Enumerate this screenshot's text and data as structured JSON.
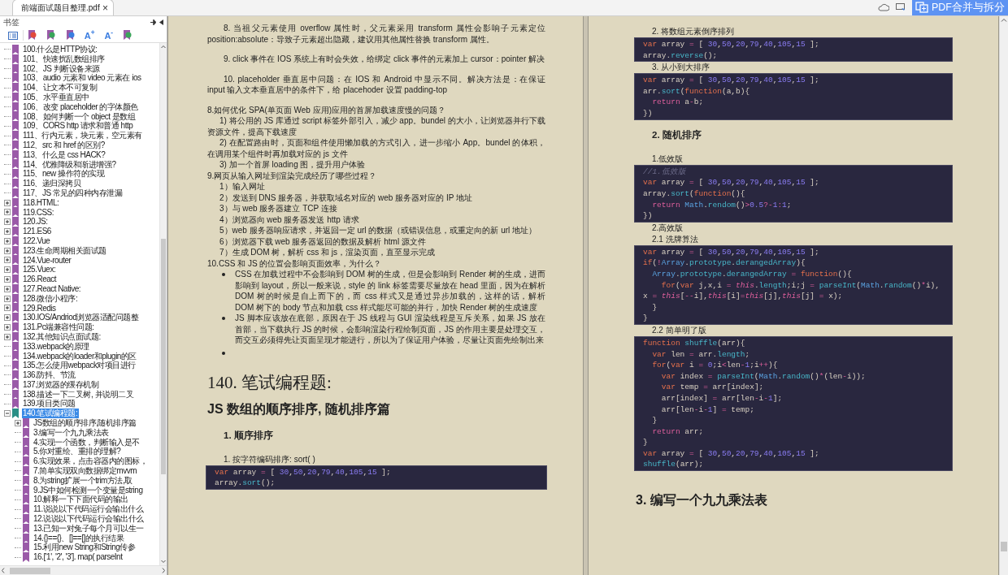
{
  "tab": {
    "title": "前端面试题目整理.pdf",
    "close": "×"
  },
  "merge_button": "PDF合并与拆分",
  "bookmarks": {
    "title": "书签",
    "tools": [
      {
        "kind": "outline"
      },
      {
        "kind": "bookmark",
        "color": "#e24a3b"
      },
      {
        "kind": "bookmark",
        "color": "#3aa55a"
      },
      {
        "kind": "bookmark",
        "color": "#3b7de0"
      },
      {
        "kind": "font",
        "label": "A$^{+}$"
      },
      {
        "kind": "font",
        "label": "A$^{-}$"
      },
      {
        "kind": "bookmark",
        "color": "#3aa55a"
      }
    ],
    "items": [
      {
        "label": "100.什么是HTTP协议:",
        "selected": false
      },
      {
        "label": "101、快速扰乱数组排序",
        "selected": false
      },
      {
        "label": "102、JS 判断设备来源",
        "selected": false
      },
      {
        "label": "103、audio 元素和 video 元素在 ios",
        "selected": false
      },
      {
        "label": "104、让文本不可复制",
        "selected": false
      },
      {
        "label": "105、水平垂直居中",
        "selected": false
      },
      {
        "label": "106、改变 placeholder 的字体颜色",
        "selected": false
      },
      {
        "label": "108、如何判断一个 object 是数组",
        "selected": false
      },
      {
        "label": "109、CORS http 请求和普通 http",
        "selected": false
      },
      {
        "label": "111、行内元素，块元素，空元素有",
        "selected": false
      },
      {
        "label": "112、src 和 href 的区别?",
        "selected": false
      },
      {
        "label": "113、什么是 css HACK?",
        "selected": false
      },
      {
        "label": "114、优雅降级和渐进增强?",
        "selected": false
      },
      {
        "label": "115、new 操作符的实现",
        "selected": false
      },
      {
        "label": "116、递归深拷贝",
        "selected": false
      },
      {
        "label": "117、JS 常见的四种内存泄漏",
        "selected": false
      },
      {
        "label": "118.HTML:",
        "selected": false,
        "expanded": false
      },
      {
        "label": "119.CSS:",
        "selected": false,
        "expanded": false
      },
      {
        "label": "120.JS:",
        "selected": false,
        "expanded": false
      },
      {
        "label": "121.ES6",
        "selected": false,
        "expanded": false
      },
      {
        "label": "122.Vue",
        "selected": false,
        "expanded": false
      },
      {
        "label": "123.生命周期相关面试题",
        "selected": false,
        "expanded": false
      },
      {
        "label": "124.Vue-router",
        "selected": false,
        "expanded": false
      },
      {
        "label": "125.Vuex:",
        "selected": false,
        "expanded": false
      },
      {
        "label": "126.React",
        "selected": false,
        "expanded": false
      },
      {
        "label": "127.React Native:",
        "selected": false,
        "expanded": false
      },
      {
        "label": "128.微信小程序:",
        "selected": false,
        "expanded": false
      },
      {
        "label": "129.Redis",
        "selected": false,
        "expanded": false
      },
      {
        "label": "130.IOS/Andriod浏览器适配问题整",
        "selected": false,
        "expanded": false
      },
      {
        "label": "131.Pc端兼容性问题:",
        "selected": false,
        "expanded": false
      },
      {
        "label": "132.其他知识点面试题:",
        "selected": false,
        "expanded": false
      },
      {
        "label": "133.webpack的原理",
        "selected": false
      },
      {
        "label": "134.webpack的loader和plugin的区",
        "selected": false
      },
      {
        "label": "135.怎么使用webpack对项目进行",
        "selected": false
      },
      {
        "label": "136.防抖、节流",
        "selected": false
      },
      {
        "label": "137.浏览器的缓存机制",
        "selected": false
      },
      {
        "label": "138.描述一下二叉树, 并说明二叉",
        "selected": false
      },
      {
        "label": "139.项目类问题",
        "selected": false
      },
      {
        "label": "140.笔试编程题:",
        "selected": true,
        "expanded": true,
        "children": [
          {
            "label": "JS数组的顺序排序,随机排序篇",
            "selected": false,
            "expanded": false
          },
          {
            "label": "3.编写一个九九乘法表",
            "selected": false
          },
          {
            "label": "4.实现一个函数，判断输入是不",
            "selected": false
          },
          {
            "label": "5.你对重绘、重排的理解?",
            "selected": false
          },
          {
            "label": "6.实现效果，点击容器内的图标，",
            "selected": false
          },
          {
            "label": "7.简单实现双向数据绑定mvvm",
            "selected": false
          },
          {
            "label": "8.为string扩展一个trim方法,取",
            "selected": false
          },
          {
            "label": "9.JS中如何检测一个变量是string",
            "selected": false
          },
          {
            "label": "10.解释一下下面代码的输出",
            "selected": false
          },
          {
            "label": "11.说说以下代码运行会输出什么",
            "selected": false
          },
          {
            "label": "12.说说以下代码运行会输出什么",
            "selected": false
          },
          {
            "label": "13.已知一对兔子每个月可以生一",
            "selected": false
          },
          {
            "label": "14.{}=={}、[]==[]的执行结果",
            "selected": false
          },
          {
            "label": "15.利用new String和String传参",
            "selected": false
          },
          {
            "label": "16.['1', '2', '3']. map( parseInt",
            "selected": false
          }
        ]
      }
    ]
  },
  "pages": [
    {
      "blocks": [
        {
          "kind": "para",
          "text": "8. 当祖父元素使用 overflow 属性时，父元素采用 transform 属性会影响子元素定位 position:absolute：导致子元素超出隐藏，建议用其他属性替换 transform 属性。"
        },
        {
          "kind": "para",
          "text": "9. click 事件在 IOS 系统上有时会失效，给绑定 click 事件的元素加上 cursor：pointer 解决"
        },
        {
          "kind": "para",
          "text": "10. placeholder 垂直居中问题：在 IOS 和 Android 中显示不同。解决方法是：在保证 input 输入文本垂直居中的条件下，给 placehoder 设置 padding-top"
        },
        {
          "kind": "line",
          "text": "8.如何优化 SPA(单页面 Web 应用)应用的首屏加载速度慢的问题？"
        },
        {
          "kind": "step",
          "text": "1) 将公用的 JS 库通过 script 标签外部引入，减少 app。bundel 的大小，让浏览器并行下载资源文件，提高下载速度"
        },
        {
          "kind": "step",
          "text": "2) 在配置路由时，页面和组件使用懒加载的方式引入，进一步缩小 App。bundel 的体积，在调用某个组件时再加载对应的 js 文件"
        },
        {
          "kind": "step",
          "text": "3) 加一个首屏 loading 图，提升用户体验"
        },
        {
          "kind": "line",
          "text": "9.网页从输入网址到渲染完成经历了哪些过程？"
        },
        {
          "kind": "step",
          "text": "1）输入网址"
        },
        {
          "kind": "step",
          "text": "2）发送到 DNS 服务器，并获取域名对应的 web 服务器对应的 IP 地址"
        },
        {
          "kind": "step",
          "text": "3）与 web 服务器建立 TCP 连接"
        },
        {
          "kind": "step",
          "text": "4）浏览器向 web 服务器发送 http 请求"
        },
        {
          "kind": "step",
          "text": "5）web 服务器响应请求，并返回一定 url 的数据（或错误信息，或重定向的新 url 地址）"
        },
        {
          "kind": "step",
          "text": "6）浏览器下载 web 服务器返回的数据及解析 html 源文件"
        },
        {
          "kind": "step",
          "text": "7）生成 DOM 树，解析 css 和 js，渲染页面，直至显示完成"
        },
        {
          "kind": "line",
          "text": "10.CSS 和 JS 的位置会影响页面效率，为什么？"
        },
        {
          "kind": "bullet",
          "text": "CSS 在加载过程中不会影响到 DOM 树的生成，但是会影响到 Render 树的生成，进而影响到 layout，所以一般来说，style 的 link 标签需要尽量放在 head 里面，因为在解析 DOM 树的时候是自上而下的，而 css 样式又是通过异步加载的，这样的话，解析 DOM 树下的 body 节点和加载 css 样式能尽可能的并行，加快 Render 树的生成速度"
        },
        {
          "kind": "bullet",
          "text": "JS 脚本应该放在底部，原因在于 JS 线程与 GUI 渲染线程是互斥关系，如果 JS 放在首部，当下载执行 JS 的时候，会影响渲染行程绘制页面，JS 的作用主要是处理交互，而交互必须得先让页面呈现才能进行，所以为了保证用户体验，尽量让页面先绘制出来"
        },
        {
          "kind": "bullet_empty"
        },
        {
          "kind": "h1",
          "text": "140. 笔试编程题:"
        },
        {
          "kind": "h2",
          "text": "JS 数组的顺序排序, 随机排序篇"
        },
        {
          "kind": "h3",
          "text": "1. 顺序排序"
        },
        {
          "kind": "item",
          "text": "1.  按字符编码排序: sort( )"
        },
        {
          "kind": "code",
          "lines": [
            "var array = [ 30,50,20,79,40,105,15 ];",
            "array.sort();"
          ]
        }
      ]
    },
    {
      "blocks": [
        {
          "kind": "item",
          "text": "2.  将数组元素倒序排列"
        },
        {
          "kind": "code",
          "lines": [
            "var array = [ 30,50,20,79,40,105,15 ];",
            "array.reverse();"
          ]
        },
        {
          "kind": "item",
          "text": "3.  从小到大排序"
        },
        {
          "kind": "code",
          "lines": [
            "var array = [ 30,50,20,79,40,105,15 ];",
            "arr.sort(function(a,b){",
            "  return a-b;",
            "})"
          ]
        },
        {
          "kind": "h3",
          "text": "2. 随机排序"
        },
        {
          "kind": "item",
          "text": "1.低效版"
        },
        {
          "kind": "code",
          "lines": [
            "//1.低效版",
            "var array = [ 30,50,20,79,40,105,15 ];",
            "array.sort(function(){",
            "  return Math.rendom()>0.5?-1:1;",
            "})"
          ]
        },
        {
          "kind": "item",
          "text": "2.高效版"
        },
        {
          "kind": "item",
          "text": "2.1 洗牌算法"
        },
        {
          "kind": "code",
          "lines": [
            "var array = [ 30,50,20,79,40,105,15 ];",
            "if(!Array.prototype.derangedArray){",
            "  Array.prototype.derangedArray = function(){",
            "    for(var j,x,i = this.length;i;j = parseInt(Math.random()*i),x = this[--i],this[i]=this[j],this[j] = x);",
            "  }",
            "}"
          ]
        },
        {
          "kind": "item",
          "text": "2.2 简单明了版"
        },
        {
          "kind": "code",
          "lines": [
            "function shuffle(arr){",
            "  var len = arr.length;",
            "  for(var i = 0;i<len-1;i++){",
            "    var index = parseInt(Math.random()*(len-i));",
            "    var temp = arr[index];",
            "    arr[index] = arr[len-i-1];",
            "    arr[len-i-1] = temp;",
            "  }",
            "  return arr;",
            "}",
            "var array = [ 30,50,20,79,40,105,15 ];",
            "shuffle(arr);"
          ]
        },
        {
          "kind": "h2",
          "text": "3. 编写一个九九乘法表"
        }
      ]
    }
  ]
}
